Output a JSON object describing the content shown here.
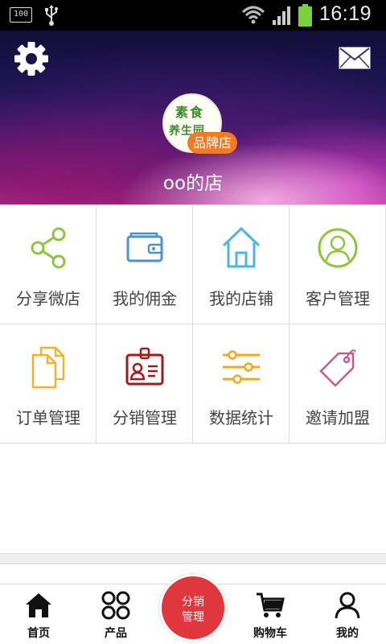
{
  "status_bar": {
    "battery_left_label": "100",
    "time": "16:19"
  },
  "header": {
    "shop_name": "oo的店",
    "avatar_text_line1": "素食",
    "avatar_text_line2": "养生园",
    "brand_badge": "品牌店"
  },
  "grid": {
    "items": [
      {
        "label": "分享微店",
        "icon": "share-icon",
        "color": "#8cc63f"
      },
      {
        "label": "我的佣金",
        "icon": "wallet-icon",
        "color": "#4a90d9"
      },
      {
        "label": "我的店铺",
        "icon": "home-icon",
        "color": "#4ab8d8"
      },
      {
        "label": "客户管理",
        "icon": "user-circle-icon",
        "color": "#8cc63f"
      },
      {
        "label": "订单管理",
        "icon": "documents-icon",
        "color": "#f2b230"
      },
      {
        "label": "分销管理",
        "icon": "id-badge-icon",
        "color": "#a11b1b"
      },
      {
        "label": "数据统计",
        "icon": "sliders-icon",
        "color": "#f2a81d"
      },
      {
        "label": "邀请加盟",
        "icon": "tag-icon",
        "color": "#c85a8a"
      }
    ]
  },
  "tab_bar": {
    "items": [
      {
        "label": "首页",
        "icon": "home-icon"
      },
      {
        "label": "产品",
        "icon": "grid-icon"
      },
      {
        "label": "购物车",
        "icon": "cart-icon"
      },
      {
        "label": "我的",
        "icon": "user-icon"
      }
    ],
    "center_label": "分销\n管理",
    "center_color": "#e0373f"
  }
}
